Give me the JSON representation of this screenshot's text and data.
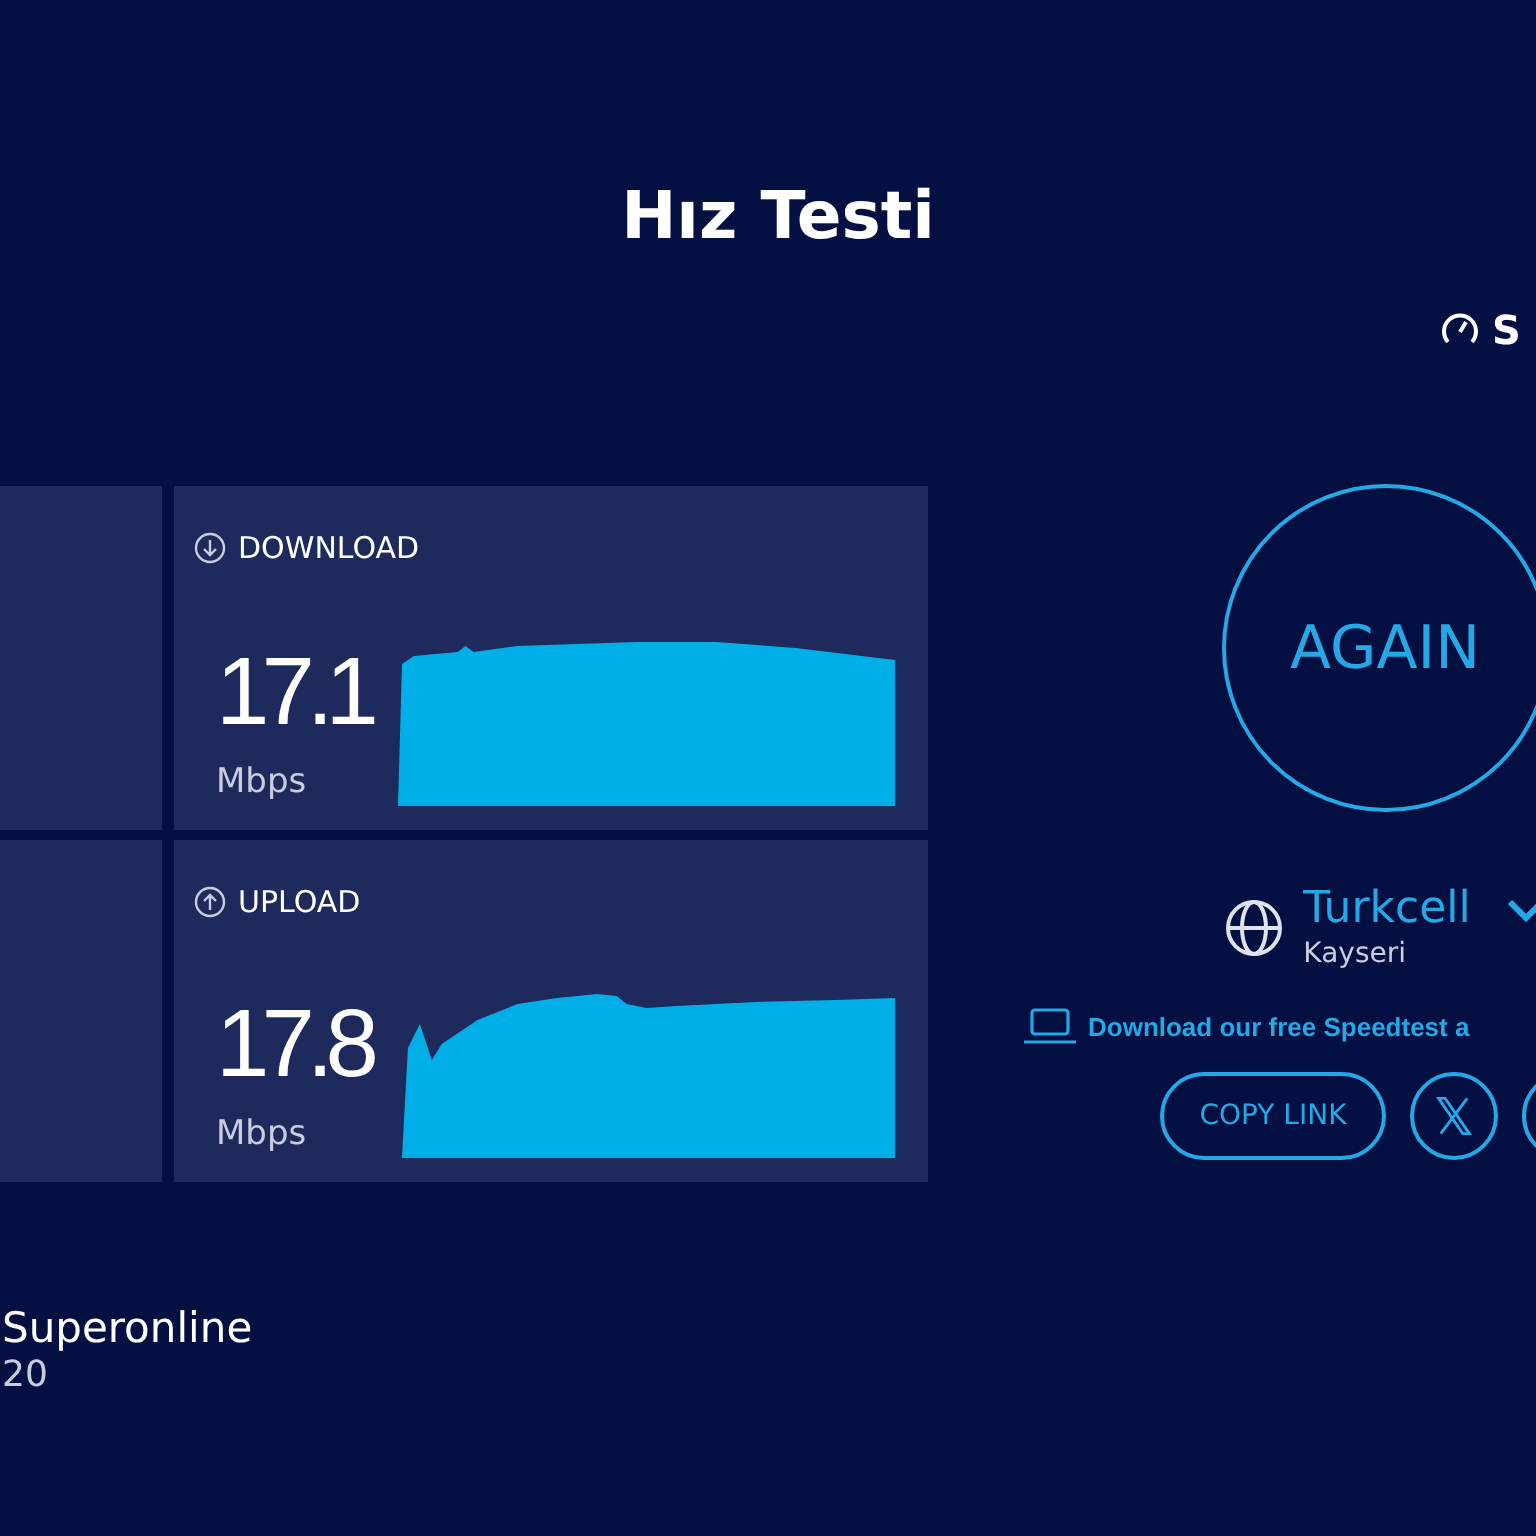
{
  "title": "Hız Testi",
  "brand": {
    "text": "S"
  },
  "results": [
    {
      "kind": "download",
      "label": "DOWNLOAD",
      "value": "17.1",
      "unit": "Mbps"
    },
    {
      "kind": "upload",
      "label": "UPLOAD",
      "value": "17.8",
      "unit": "Mbps"
    }
  ],
  "again_button": {
    "label": "AGAIN"
  },
  "server": {
    "provider": "Turkcell",
    "location": "Kayseri"
  },
  "app_link": {
    "text": "Download our free Speedtest a"
  },
  "share": {
    "copy_link": "COPY LINK"
  },
  "isp": {
    "name": "Superonline",
    "detail": "20"
  }
}
